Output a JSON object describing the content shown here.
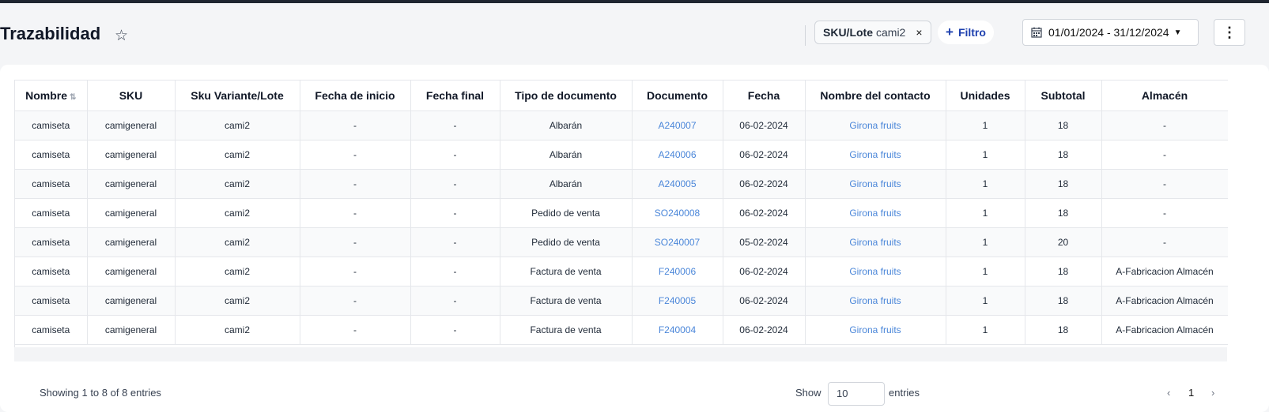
{
  "header": {
    "title": "Trazabilidad",
    "star_icon": "☆",
    "filter_chip": {
      "key": "SKU/Lote",
      "value": "cami2",
      "close": "×"
    },
    "add_filter": {
      "plus": "+",
      "label": "Filtro"
    },
    "date_range": "01/01/2024 - 31/12/2024",
    "more_icon": "⋮"
  },
  "table": {
    "columns": [
      "Nombre",
      "SKU",
      "Sku Variante/Lote",
      "Fecha de inicio",
      "Fecha final",
      "Tipo de documento",
      "Documento",
      "Fecha",
      "Nombre del contacto",
      "Unidades",
      "Subtotal",
      "Almacén"
    ],
    "rows": [
      [
        "camiseta",
        "camigeneral",
        "cami2",
        "-",
        "-",
        "Albarán",
        "A240007",
        "06-02-2024",
        "Girona fruits",
        "1",
        "18",
        "-"
      ],
      [
        "camiseta",
        "camigeneral",
        "cami2",
        "-",
        "-",
        "Albarán",
        "A240006",
        "06-02-2024",
        "Girona fruits",
        "1",
        "18",
        "-"
      ],
      [
        "camiseta",
        "camigeneral",
        "cami2",
        "-",
        "-",
        "Albarán",
        "A240005",
        "06-02-2024",
        "Girona fruits",
        "1",
        "18",
        "-"
      ],
      [
        "camiseta",
        "camigeneral",
        "cami2",
        "-",
        "-",
        "Pedido de venta",
        "SO240008",
        "06-02-2024",
        "Girona fruits",
        "1",
        "18",
        "-"
      ],
      [
        "camiseta",
        "camigeneral",
        "cami2",
        "-",
        "-",
        "Pedido de venta",
        "SO240007",
        "05-02-2024",
        "Girona fruits",
        "1",
        "20",
        "-"
      ],
      [
        "camiseta",
        "camigeneral",
        "cami2",
        "-",
        "-",
        "Factura de venta",
        "F240006",
        "06-02-2024",
        "Girona fruits",
        "1",
        "18",
        "A-Fabricacion Almacén"
      ],
      [
        "camiseta",
        "camigeneral",
        "cami2",
        "-",
        "-",
        "Factura de venta",
        "F240005",
        "06-02-2024",
        "Girona fruits",
        "1",
        "18",
        "A-Fabricacion Almacén"
      ],
      [
        "camiseta",
        "camigeneral",
        "cami2",
        "-",
        "-",
        "Factura de venta",
        "F240004",
        "06-02-2024",
        "Girona fruits",
        "1",
        "18",
        "A-Fabricacion Almacén"
      ]
    ]
  },
  "footer": {
    "showing": "Showing 1 to 8 of 8 entries",
    "show_label": "Show",
    "page_size": "10",
    "entries_label": "entries",
    "prev": "‹",
    "page": "1",
    "next": "›"
  }
}
